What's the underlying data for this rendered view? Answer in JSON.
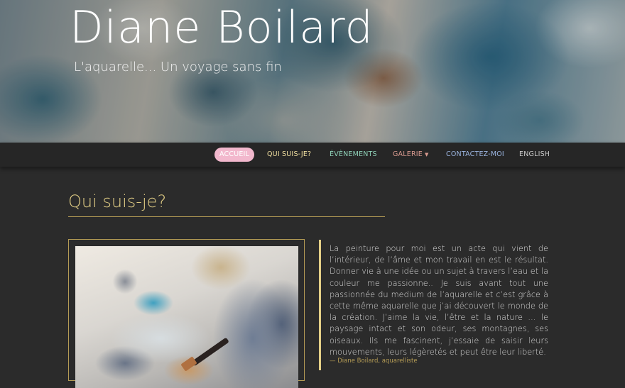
{
  "header": {
    "title": "Diane Boilard",
    "tagline": "L'aquarelle... Un voyage sans fin"
  },
  "nav": {
    "items": [
      {
        "label": "ACCUEIL",
        "color": "#ffffff",
        "active": true
      },
      {
        "label": "QUI SUIS-JE?",
        "color": "#f1dfa0"
      },
      {
        "label": "ÉVÈNEMENTS",
        "color": "#8fd1b8"
      },
      {
        "label": "GALERIE",
        "color": "#d89a8f"
      },
      {
        "label": "CONTACTEZ-MOI",
        "color": "#9bb5e0"
      },
      {
        "label": "ENGLISH",
        "color": "#c8c8c8"
      }
    ],
    "active_bg": "#f2b8cd"
  },
  "about": {
    "heading": "Qui suis-je?",
    "quote": "La peinture pour moi est un acte qui vient de l’intérieur, de l’âme et mon travail en est le résultat. Donner vie à une idée ou un sujet à travers l’eau et la couleur me passionne.. Je suis avant tout une passionnée du medium de l’aquarelle et c’est grâce à cette même aquarelle que j’ai découvert le monde de la création. J’aime la vie, l’être et la nature … le paysage intact et son odeur, ses montagnes, ses oiseaux. Ils me fascinent, j’essaie de saisir leurs mouvements, leurs légèretés et peut être leur liberté.",
    "cite": "— Diane Boilard, aquarelliste"
  },
  "colors": {
    "accent": "#e3cf86",
    "rule": "#b59c55",
    "background": "#2b2b2b",
    "navbar": "#262626"
  }
}
